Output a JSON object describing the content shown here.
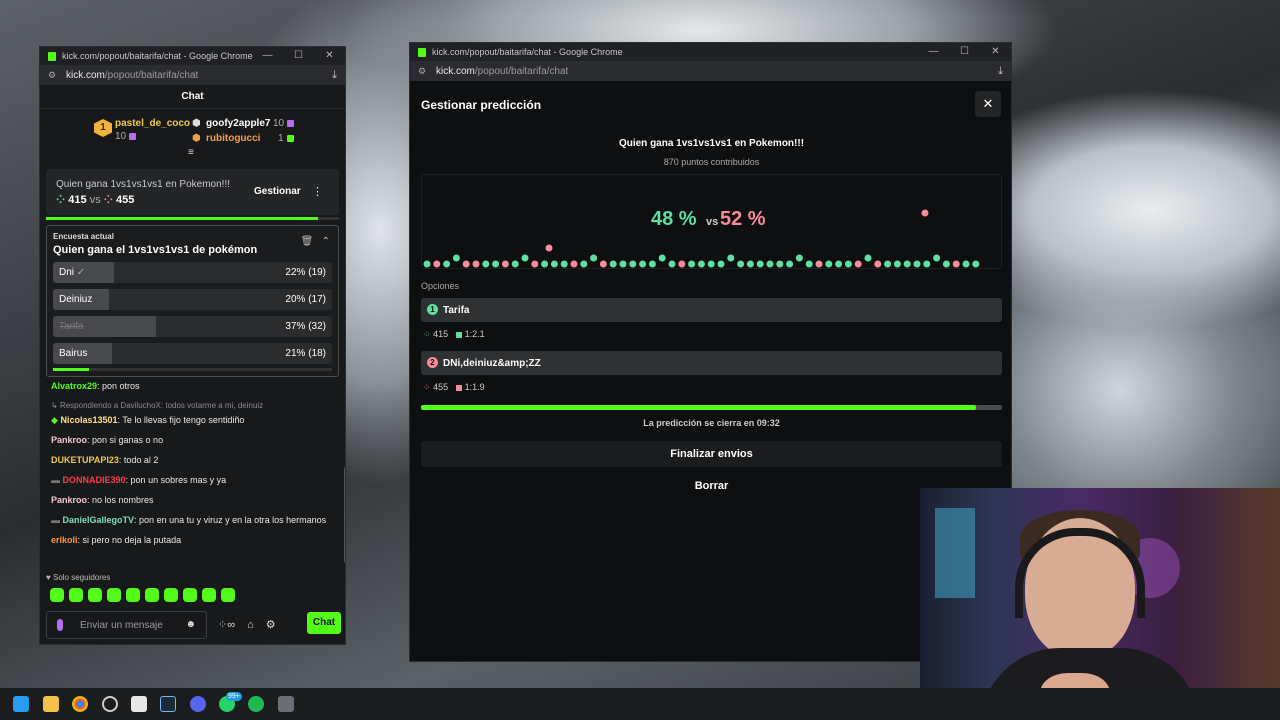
{
  "chat_window": {
    "title": "kick.com/popout/baitarifa/chat - Google Chrome",
    "url_host": "kick.com",
    "url_path": "/popout/baitarifa/chat",
    "header": "Chat",
    "leaders": [
      {
        "rank": "1",
        "name": "pastel_de_coco",
        "count": "10"
      },
      {
        "name": "goofy2apple7",
        "count": "10"
      },
      {
        "name": "rubitogucci",
        "count": "1"
      }
    ],
    "pinned": {
      "question": "Quien gana 1vs1vs1vs1 en Pokemon!!!",
      "left_score": "415",
      "vs": "vs",
      "right_score": "455",
      "manage_label": "Gestionar"
    },
    "poll": {
      "label": "Encuesta actual",
      "title": "Quien gana el 1vs1vs1vs1 de pokémon",
      "options": [
        {
          "name": "Dni",
          "pct_label": "22% (19)",
          "fraction": 0.22
        },
        {
          "name": "Deiniuz",
          "pct_label": "20% (17)",
          "fraction": 0.2
        },
        {
          "name": "Tarifa",
          "pct_label": "37% (32)",
          "fraction": 0.37
        },
        {
          "name": "Bairus",
          "pct_label": "21% (18)",
          "fraction": 0.21
        }
      ]
    },
    "messages": [
      {
        "user": "Alvatrox29",
        "text": ": pon otros",
        "color": "#53fc18"
      },
      {
        "reply": "Respondiendo a DaviluchoX: todos votarme a mi, deinuiz"
      },
      {
        "user": "Nicolas13501",
        "text": ": Te lo llevas fijo tengo sentidiño",
        "color": "#ffe08a"
      },
      {
        "user": "Pankroo",
        "text": ": pon si ganas o no",
        "color": "#f5c5d0"
      },
      {
        "user": "DUKETUPAPI23",
        "text": ": todo al 2",
        "color": "#f1c94a"
      },
      {
        "user": "DONNADIE390",
        "text": ": pon un sobres mas y ya",
        "color": "#ff3b4a"
      },
      {
        "user": "Pankroo",
        "text": ": no los nombres",
        "color": "#f5c5d0"
      },
      {
        "user": "DanielGallegoTV",
        "text": ": pon en una tu y viruz y en la otra los hermanos",
        "color": "#7ce0b9"
      },
      {
        "user": "erikoli",
        "text": ": si pero no deja la putada",
        "color": "#ff9a3c"
      }
    ],
    "followers_only": "Solo seguidores",
    "input_placeholder": "Enviar un mensaje",
    "send_label": "Chat"
  },
  "prediction_window": {
    "title": "kick.com/popout/baitarifa/chat - Google Chrome",
    "url_host": "kick.com",
    "url_path": "/popout/baitarifa/chat",
    "heading": "Gestionar predicción",
    "question": "Quien gana 1vs1vs1vs1 en Pokemon!!!",
    "points": "870 puntos contribuidos",
    "left_pct": "48 %",
    "vs": "vs",
    "right_pct": "52 %",
    "options_label": "Opciones",
    "options": [
      {
        "num": "1",
        "name": "Tarifa",
        "points": "415",
        "ratio": "1:2.1",
        "color": "#5ee0a0"
      },
      {
        "num": "2",
        "name": "DNi,deiniuz&amp;ZZ",
        "points": "455",
        "ratio": "1:1.9",
        "color": "#f78b9c"
      }
    ],
    "time_fraction": 0.955,
    "closing_text": "La predicción se cierra en 09:32",
    "finalize_label": "Finalizar envios",
    "delete_label": "Borrar"
  }
}
